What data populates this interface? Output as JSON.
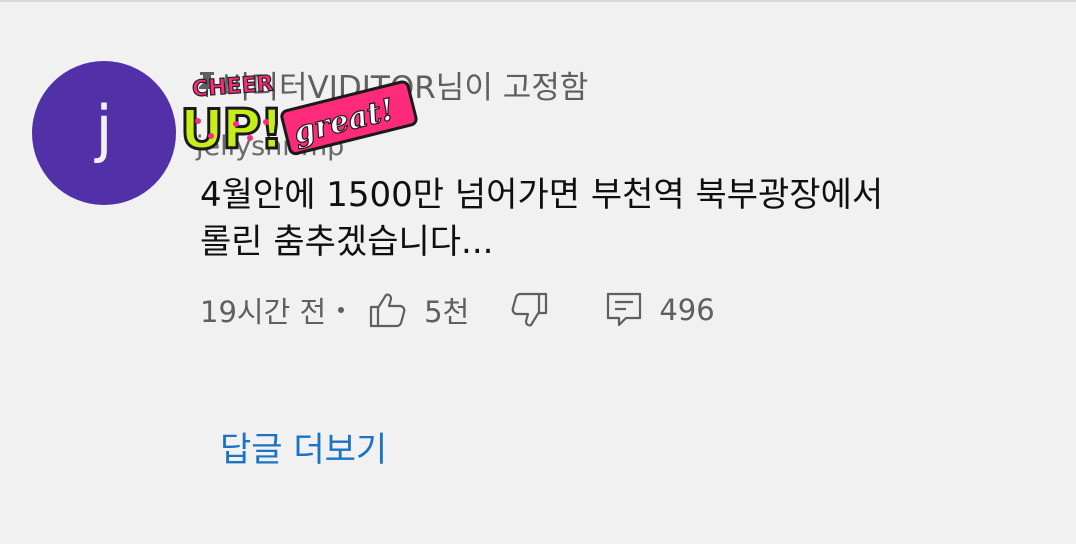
{
  "comment": {
    "avatar_letter": "j",
    "pinned_label": "비디터VIDITOR님이 고정함",
    "author_name": "jellyshrimp",
    "sticker": {
      "top_text": "CHEER",
      "main_text": "UP!",
      "side_text": "great!"
    },
    "text_line1": "4월안에 1500만 넘어가면 부천역 북부광장에서",
    "text_line2": "롤린 춤추겠습니다...",
    "timestamp": "19시간 전",
    "like_count": "5천",
    "reply_count": "496",
    "more_replies_label": "답글 더보기"
  },
  "icons": {
    "pin": "pin-icon",
    "like": "thumbs-up-icon",
    "dislike": "thumbs-down-icon",
    "reply": "reply-comment-icon"
  },
  "colors": {
    "background": "#f1f1f1",
    "avatar": "#5130a8",
    "link": "#1a73c4",
    "secondary_text": "#5f5f5f",
    "primary_text": "#0f0f0f"
  }
}
